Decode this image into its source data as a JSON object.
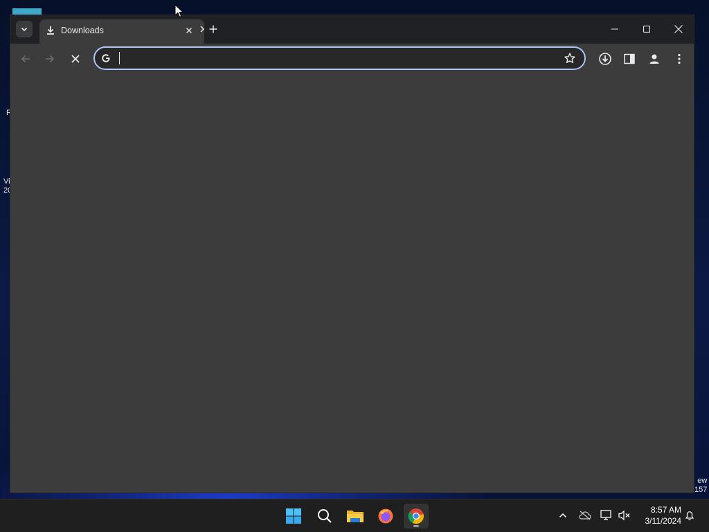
{
  "desktop": {
    "labels": [
      {
        "text": "R"
      },
      {
        "text": "Vi\n20"
      },
      {
        "text": "ew\n157"
      }
    ]
  },
  "browser": {
    "tab": {
      "title": "Downloads",
      "favicon": "download-icon"
    },
    "omnibox": {
      "value": "",
      "placeholder": ""
    },
    "accent": "#a8c7fa"
  },
  "taskbar": {
    "apps": [
      "start",
      "search",
      "file-explorer",
      "firefox",
      "chrome"
    ],
    "active_app": "chrome",
    "clock": {
      "time": "8:57 AM",
      "date": "3/11/2024"
    }
  }
}
